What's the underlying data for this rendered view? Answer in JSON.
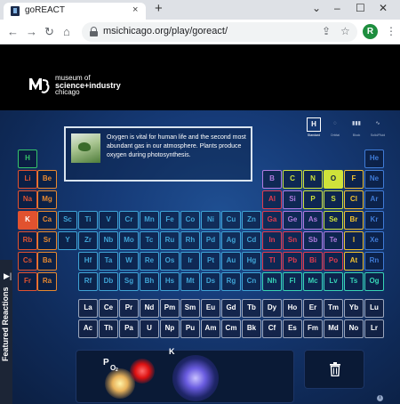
{
  "browser": {
    "tab_title": "goREACT",
    "tab_close": "×",
    "new_tab": "+",
    "url": "msichicago.org/play/goreact/",
    "avatar_letter": "R",
    "icons": [
      "back-arrow-icon",
      "forward-arrow-icon",
      "reload-icon",
      "home-icon",
      "lock-icon",
      "share-icon",
      "star-icon",
      "kebab-menu-icon"
    ]
  },
  "header": {
    "logo_line1": "museum of",
    "logo_line2": "science+industry",
    "logo_line3": "chicago"
  },
  "info": {
    "text": "Oxygen is vital for human life and the second most abundant gas in our atmosphere. Plants produce oxygen during photosynthesis."
  },
  "view_controls": {
    "active_letter": "H",
    "labels": [
      "Standard",
      "Orbital",
      "Block",
      "Solid/Fluid"
    ]
  },
  "colors": {
    "alkali": "#e1522f",
    "alkaline": "#e8892f",
    "transition": "#3fa4d6",
    "post": "#e23b4f",
    "metalloid": "#b07be0",
    "nonmetal": "#cfe23a",
    "halogen": "#f2c230",
    "noble": "#3f7bd6",
    "lanthanide": "#9aa6bd",
    "superheavy": "#37d4b6",
    "hydrogen": "#35c46a"
  },
  "periodic_table": {
    "period1": [
      "H",
      "He"
    ],
    "period2": [
      "Li",
      "Be",
      "B",
      "C",
      "N",
      "O",
      "F",
      "Ne"
    ],
    "period3": [
      "Na",
      "Mg",
      "Al",
      "Si",
      "P",
      "S",
      "Cl",
      "Ar"
    ],
    "period4": [
      "K",
      "Ca",
      "Sc",
      "Ti",
      "V",
      "Cr",
      "Mn",
      "Fe",
      "Co",
      "Ni",
      "Cu",
      "Zn",
      "Ga",
      "Ge",
      "As",
      "Se",
      "Br",
      "Kr"
    ],
    "period5": [
      "Rb",
      "Sr",
      "Y",
      "Zr",
      "Nb",
      "Mo",
      "Tc",
      "Ru",
      "Rh",
      "Pd",
      "Ag",
      "Cd",
      "In",
      "Sn",
      "Sb",
      "Te",
      "I",
      "Xe"
    ],
    "period6": [
      "Cs",
      "Ba",
      "Hf",
      "Ta",
      "W",
      "Re",
      "Os",
      "Ir",
      "Pt",
      "Au",
      "Hg",
      "Tl",
      "Pb",
      "Bi",
      "Po",
      "At",
      "Rn"
    ],
    "period7": [
      "Fr",
      "Ra",
      "Rf",
      "Db",
      "Sg",
      "Bh",
      "Hs",
      "Mt",
      "Ds",
      "Rg",
      "Cn",
      "Nh",
      "Fl",
      "Mc",
      "Lv",
      "Ts",
      "Og"
    ],
    "lanthanides": [
      "La",
      "Ce",
      "Pr",
      "Nd",
      "Pm",
      "Sm",
      "Eu",
      "Gd",
      "Tb",
      "Dy",
      "Ho",
      "Er",
      "Tm",
      "Yb",
      "Lu"
    ],
    "actinides": [
      "Ac",
      "Th",
      "Pa",
      "U",
      "Np",
      "Pu",
      "Am",
      "Cm",
      "Bk",
      "Cf",
      "Es",
      "Fm",
      "Md",
      "No",
      "Lr"
    ]
  },
  "sidebar": {
    "label": "Featured Reactions"
  },
  "reaction": {
    "element_k": "K",
    "element_p": "P",
    "element_o": "O",
    "subscript": "2"
  }
}
